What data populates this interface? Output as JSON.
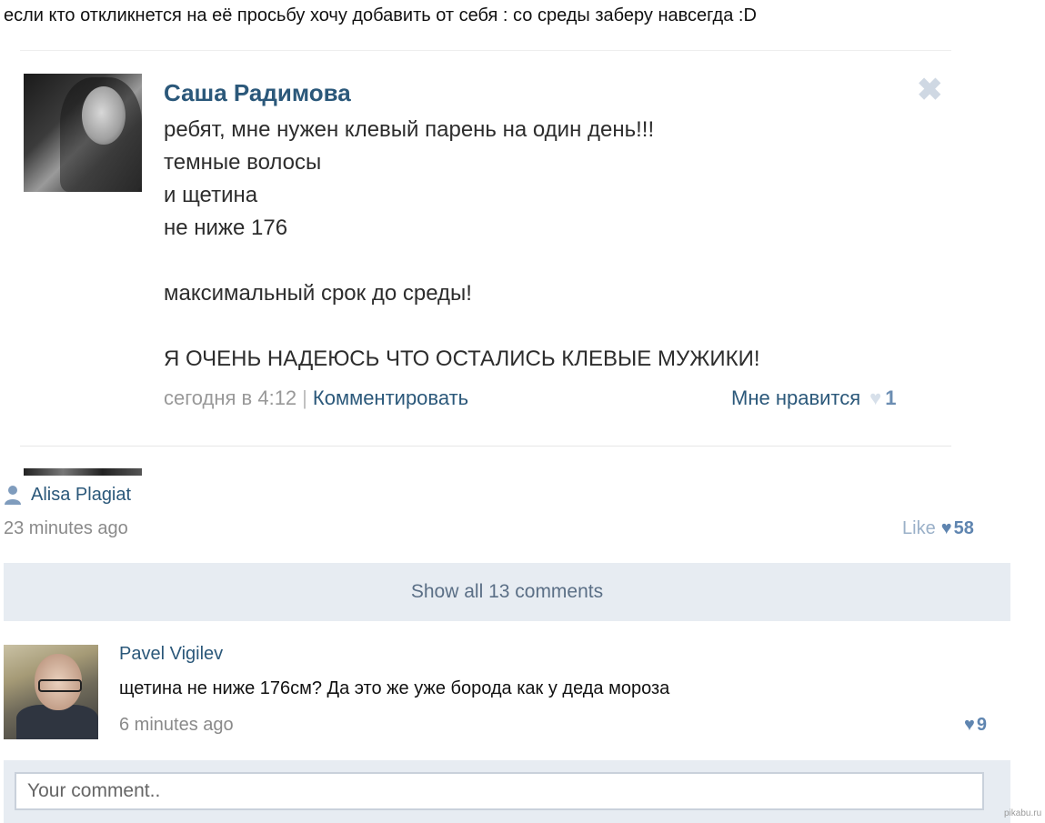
{
  "caption": "если кто откликнется на её просьбу хочу добавить от себя : со среды заберу навсегда :D",
  "embedded_post": {
    "author": "Саша Радимова",
    "close_icon": "close-icon",
    "lines": [
      "ребят, мне нужен клевый парень на один день!!!",
      "темные волосы",
      "и щетина",
      "не ниже 176",
      "максимальный срок до среды!",
      "Я ОЧЕНЬ НАДЕЮСЬ ЧТО ОСТАЛИСЬ КЛЕВЫЕ МУЖИКИ!"
    ],
    "time": "сегодня в 4:12",
    "separator": "|",
    "comment_label": "Комментировать",
    "like_label": "Мне нравится",
    "like_count": "1"
  },
  "post": {
    "user_icon": "user-icon",
    "user_name": "Alisa Plagiat",
    "time": "23 minutes ago",
    "like_label": "Like",
    "like_count": "58"
  },
  "show_all_label": "Show all 13 comments",
  "comment": {
    "author": "Pavel Vigilev",
    "text": "щетина не ниже 176см? Да это же уже борода как у деда мороза",
    "time": "6 minutes ago",
    "like_count": "9"
  },
  "comment_input": {
    "placeholder": "Your comment.."
  },
  "watermark": "pikabu.ru",
  "colors": {
    "link": "#2b587a",
    "muted": "#8a8a8a",
    "panel": "#e7ecf2",
    "heart": "#5f85b0"
  }
}
